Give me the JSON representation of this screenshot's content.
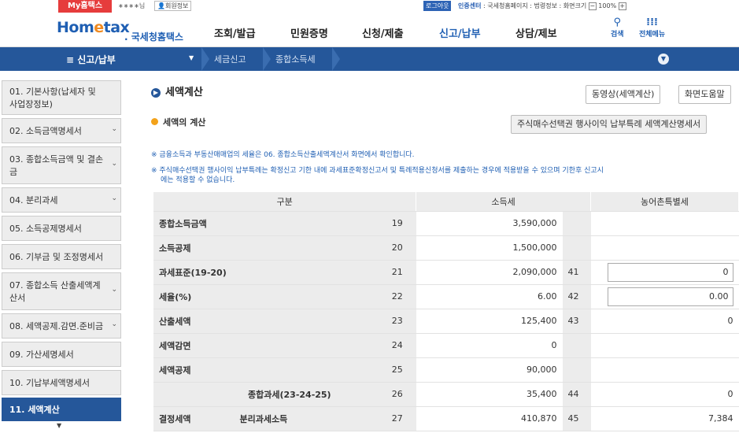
{
  "topbar": {
    "my_label": "My홈택스",
    "user": "∗∗∗∗님",
    "member_info": "회원정보",
    "logout": "로그아웃",
    "right_text_bold": "인증센터",
    "right_text": " : 국세청홈페이지 : 법령정보 : 화면크기",
    "zoom_minus": "−",
    "zoom": "100%",
    "zoom_plus": "+"
  },
  "nav": {
    "logo_main_a": "Hom",
    "logo_main_b": "e",
    "logo_main_c": "tax",
    "logo_sub": ". 국세청홈택스",
    "items": [
      "조회/발급",
      "민원증명",
      "신청/제출",
      "신고/납부",
      "상담/제보"
    ],
    "search_label": "검색",
    "menu_label": "전체메뉴"
  },
  "bar": {
    "title": "≡  신고/납부",
    "crumb1": "세금신고",
    "crumb2": "종합소득세"
  },
  "sidebar": {
    "items": [
      {
        "label": "01. 기본사항(납세자 및 사업장정보)"
      },
      {
        "label": "02. 소득금액명세서"
      },
      {
        "label": "03. 종합소득금액 및 결손금"
      },
      {
        "label": "04. 분리과세"
      },
      {
        "label": "05. 소득공제명세서"
      },
      {
        "label": "06. 기부금 및 조정명세서"
      },
      {
        "label": "07. 종합소득 산출세액계산서"
      },
      {
        "label": "08. 세액공제.감면.준비금"
      },
      {
        "label": "09. 가산세명세서"
      },
      {
        "label": "10. 기납부세액명세서"
      },
      {
        "label": "11. 세액계산"
      }
    ]
  },
  "main": {
    "title": "세액계산",
    "video_button": "동영상(세액계산)",
    "help_button": "화면도움말",
    "subtitle": "세액의 계산",
    "stock_button": "주식매수선택권 행사이익 납부특례 세액계산명세서",
    "note1": "※ 금융소득과 부동산매매업의 세율은 06. 종합소득산출세액계산서 화면에서 확인합니다.",
    "note2a": "※ 주식매수선택권 행사이익 납부특례는 확정신고 기한 내에 과세표준확정신고서 및 특례적용신청서를 제출하는 경우에 적용받을 수 있으며 기한후 신고시",
    "note2b": "에는 적용할 수 없습니다."
  },
  "table": {
    "headers": [
      "구분",
      "소득세",
      "농어촌특별세"
    ],
    "rows": [
      {
        "label": "종합소득금액",
        "num": "19",
        "val": "3,590,000",
        "num2": "",
        "val2": ""
      },
      {
        "label": "소득공제",
        "num": "20",
        "val": "1,500,000",
        "num2": "",
        "val2": ""
      },
      {
        "label": "과세표준(19-20)",
        "num": "21",
        "val": "2,090,000",
        "num2": "41",
        "val2": "0"
      },
      {
        "label": "세율(%)",
        "num": "22",
        "val": "6.00",
        "num2": "42",
        "val2": "0.00"
      },
      {
        "label": "산출세액",
        "num": "23",
        "val": "125,400",
        "num2": "43",
        "val2": "0"
      },
      {
        "label": "세액감면",
        "num": "24",
        "val": "0",
        "num2": "",
        "val2": ""
      },
      {
        "label": "세액공제",
        "num": "25",
        "val": "90,000",
        "num2": "",
        "val2": ""
      },
      {
        "label": "종합과세(23-24-25)",
        "num": "26",
        "val": "35,400",
        "num2": "44",
        "val2": "0"
      },
      {
        "label": "분리과세소득",
        "num": "27",
        "val": "410,870",
        "num2": "45",
        "val2": "7,384"
      }
    ],
    "group_label": "결정세액"
  }
}
